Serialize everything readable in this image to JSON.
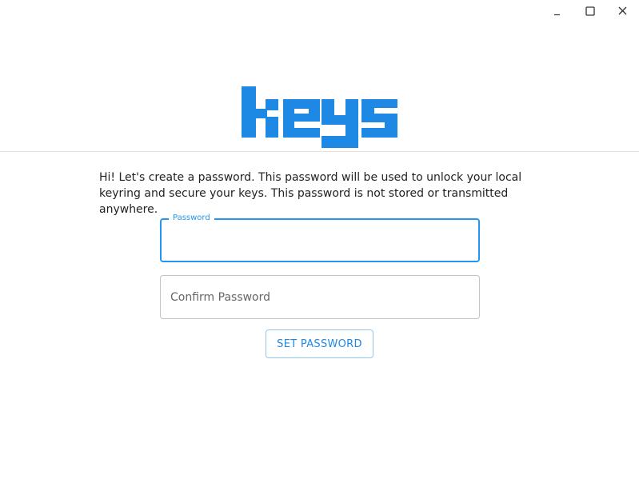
{
  "window": {
    "controls": {
      "minimize": "minimize-icon",
      "maximize": "maximize-icon",
      "close": "close-icon"
    }
  },
  "header": {
    "logo_text": "keys",
    "logo_color": "#1e88e5"
  },
  "main": {
    "intro_text": "Hi! Let's create a password. This password will be used to unlock your local keyring and secure your keys. This password is not stored or transmitted anywhere.",
    "password_field": {
      "label": "Password",
      "value": ""
    },
    "confirm_field": {
      "placeholder": "Confirm Password",
      "value": ""
    },
    "set_password_label": "SET PASSWORD"
  },
  "colors": {
    "accent": "#2196f3",
    "border": "#c4c4c4",
    "text": "#222222"
  }
}
